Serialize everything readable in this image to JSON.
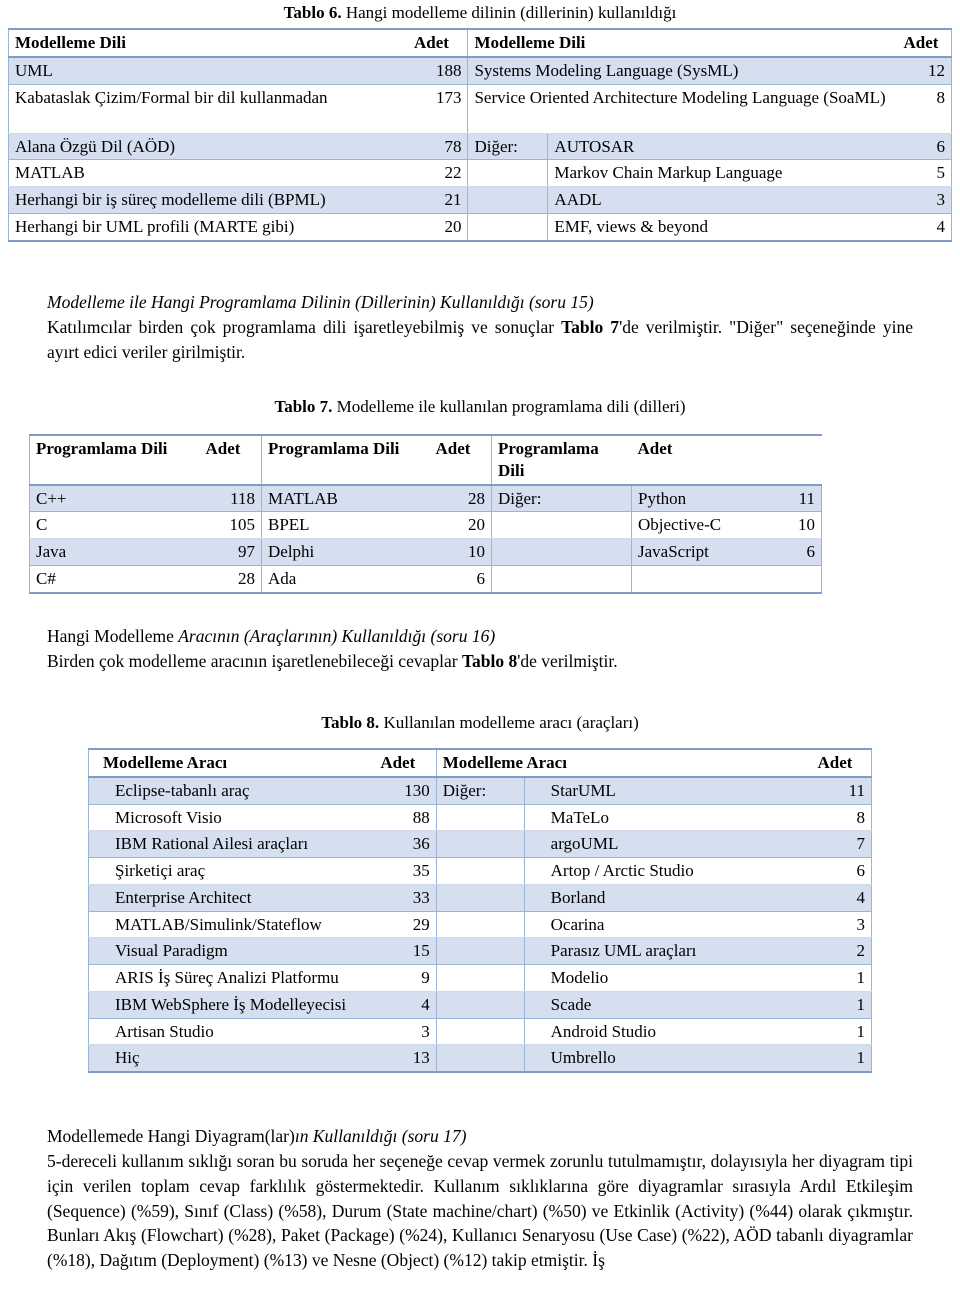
{
  "table6": {
    "caption_label": "Tablo 6.",
    "caption_text": "Hangi modelleme dilinin (dillerinin) kullanıldığı",
    "headers": [
      "Modelleme Dili",
      "Adet",
      "Modelleme Dili",
      "Adet"
    ],
    "left_rows": [
      {
        "name": "UML",
        "count": "188"
      },
      {
        "name": "Kabataslak Çizim/Formal bir dil kullanmadan",
        "count": "173"
      },
      {
        "name": "Alana Özgü Dil (AÖD)",
        "count": "78"
      },
      {
        "name": "MATLAB",
        "count": "22"
      },
      {
        "name": "Herhangi bir iş süreç modelleme dili (BPML)",
        "count": "21"
      },
      {
        "name": "Herhangi bir UML profili (MARTE gibi)",
        "count": "20"
      }
    ],
    "right_rows": [
      {
        "group": "",
        "name": "Systems Modeling Language (SysML)",
        "count": "12"
      },
      {
        "group": "",
        "name": "Service Oriented Architecture Modeling Language (SoaML)",
        "count": "8"
      },
      {
        "group": "Diğer:",
        "name": "AUTOSAR",
        "count": "6"
      },
      {
        "group": "",
        "name": "Markov Chain Markup Language",
        "count": "5"
      },
      {
        "group": "",
        "name": "AADL",
        "count": "3"
      },
      {
        "group": "",
        "name": "EMF, views & beyond",
        "count": "4"
      }
    ]
  },
  "section15": {
    "heading": "Modelleme ile Hangi Programlama Dilinin (Dillerinin) Kullanıldığı (soru 15)",
    "body_a": "Katılımcılar birden çok programlama dili işaretleyebilmiş ve sonuçlar ",
    "body_b": "Tablo 7",
    "body_c": "'de verilmiştir. \"Diğer\" seçeneğinde yine ayırt edici veriler girilmiştir."
  },
  "table7": {
    "caption_label": "Tablo 7.",
    "caption_text": "Modelleme ile kullanılan programlama dili (dilleri)",
    "headers": [
      "Programlama Dili",
      "Adet",
      "Programlama Dili",
      "Adet",
      "Programlama Dili",
      "Adet"
    ],
    "col1": [
      {
        "name": "C++",
        "count": "118"
      },
      {
        "name": "C",
        "count": "105"
      },
      {
        "name": "Java",
        "count": "97"
      },
      {
        "name": "C#",
        "count": "28"
      }
    ],
    "col2": [
      {
        "name": "MATLAB",
        "count": "28"
      },
      {
        "name": "BPEL",
        "count": "20"
      },
      {
        "name": "Delphi",
        "count": "10"
      },
      {
        "name": "Ada",
        "count": "6"
      }
    ],
    "col3": [
      {
        "group": "Diğer:",
        "name": "Python",
        "count": "11"
      },
      {
        "group": "",
        "name": "Objective-C",
        "count": "10"
      },
      {
        "group": "",
        "name": "JavaScript",
        "count": "6"
      },
      {
        "group": "",
        "name": "",
        "count": ""
      }
    ]
  },
  "section16": {
    "heading_plain": "Hangi Modelleme ",
    "heading_italic": "Aracının (Araçlarının) Kullanıldığı (soru 16)",
    "body_a": "Birden çok modelleme aracının işaretlenebileceği cevaplar ",
    "body_b": "Tablo 8",
    "body_c": "'de verilmiştir."
  },
  "table8": {
    "caption_label": "Tablo 8.",
    "caption_text": "Kullanılan modelleme aracı (araçları)",
    "headers": [
      "Modelleme Aracı",
      "Adet",
      "Modelleme Aracı",
      "Adet"
    ],
    "left_rows": [
      {
        "name": "Eclipse-tabanlı araç",
        "count": "130"
      },
      {
        "name": "Microsoft Visio",
        "count": "88"
      },
      {
        "name": "IBM Rational Ailesi araçları",
        "count": "36"
      },
      {
        "name": "Şirketiçi araç",
        "count": "35"
      },
      {
        "name": "Enterprise Architect",
        "count": "33"
      },
      {
        "name": "MATLAB/Simulink/Stateflow",
        "count": "29"
      },
      {
        "name": "Visual Paradigm",
        "count": "15"
      },
      {
        "name": "ARIS İş Süreç Analizi Platformu",
        "count": "9"
      },
      {
        "name": "IBM WebSphere İş Modelleyecisi",
        "count": "4"
      },
      {
        "name": "Artisan Studio",
        "count": "3"
      },
      {
        "name": "Hiç",
        "count": "13"
      }
    ],
    "right_rows": [
      {
        "group": "Diğer:",
        "name": "StarUML",
        "count": "11"
      },
      {
        "group": "",
        "name": "MaTeLo",
        "count": "8"
      },
      {
        "group": "",
        "name": "argoUML",
        "count": "7"
      },
      {
        "group": "",
        "name": "Artop / Arctic Studio",
        "count": "6"
      },
      {
        "group": "",
        "name": "Borland",
        "count": "4"
      },
      {
        "group": "",
        "name": "Ocarina",
        "count": "3"
      },
      {
        "group": "",
        "name": "Parasız UML araçları",
        "count": "2"
      },
      {
        "group": "",
        "name": "Modelio",
        "count": "1"
      },
      {
        "group": "",
        "name": "Scade",
        "count": "1"
      },
      {
        "group": "",
        "name": "Android Studio",
        "count": "1"
      },
      {
        "group": "",
        "name": "Umbrello",
        "count": "1"
      }
    ]
  },
  "section17": {
    "heading_plain": "Modellemede Hangi Diyagram(lar)",
    "heading_italic": "ın Kullanıldığı (soru 17)",
    "body": "5-dereceli kullanım sıklığı soran bu soruda her seçeneğe cevap vermek zorunlu tutulmamıştır, dolayısıyla her diyagram tipi için verilen toplam cevap farklılık göstermektedir. Kullanım sıklıklarına göre diyagramlar sırasıyla Ardıl Etkileşim (Sequence) (%59), Sınıf (Class) (%58), Durum (State machine/chart) (%50) ve Etkinlik (Activity) (%44) olarak çıkmıştır. Bunları Akış (Flowchart) (%28), Paket (Package) (%24), Kullanıcı Senaryosu (Use Case) (%22), AÖD tabanlı diyagramlar (%18), Dağıtım (Deployment) (%13) ve Nesne (Object) (%12) takip etmiştir. İş"
  },
  "colors": {
    "shade": "#d5dfef",
    "border": "#9bb3d4",
    "border_strong": "#7e9cc4"
  }
}
